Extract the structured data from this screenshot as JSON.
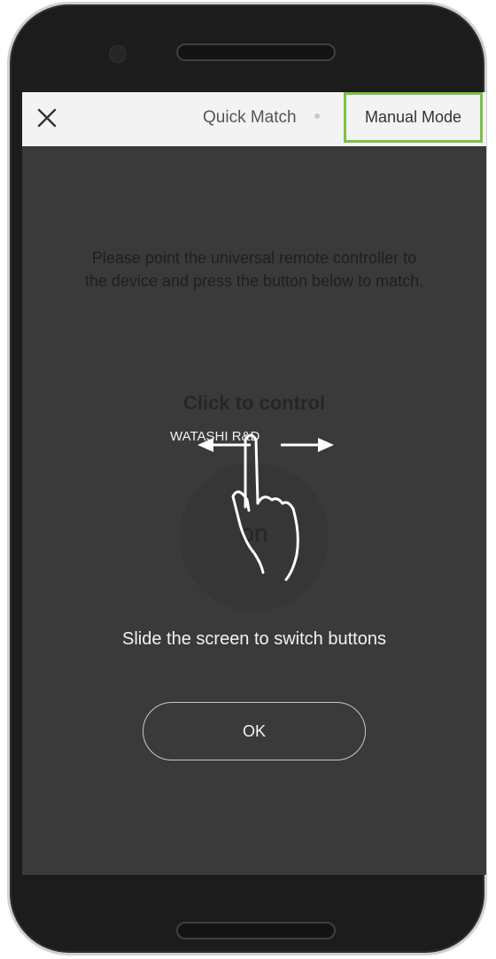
{
  "header": {
    "close_icon": "close-icon",
    "title": "Quick Match",
    "manual_mode_label": "Manual Mode"
  },
  "main": {
    "instruction": "Please point the universal remote controller to the device and press the button below to match.",
    "click_to_control": "Click to control",
    "brand": "WATASHI R&D",
    "button_label": "on",
    "gesture_icon": "swipe-hand-icon"
  },
  "overlay": {
    "hint": "Slide the screen to switch buttons",
    "ok_label": "OK"
  },
  "colors": {
    "highlight": "#7dc142",
    "screen_bg": "#3a3a3a",
    "header_bg": "#f3f3f3"
  }
}
